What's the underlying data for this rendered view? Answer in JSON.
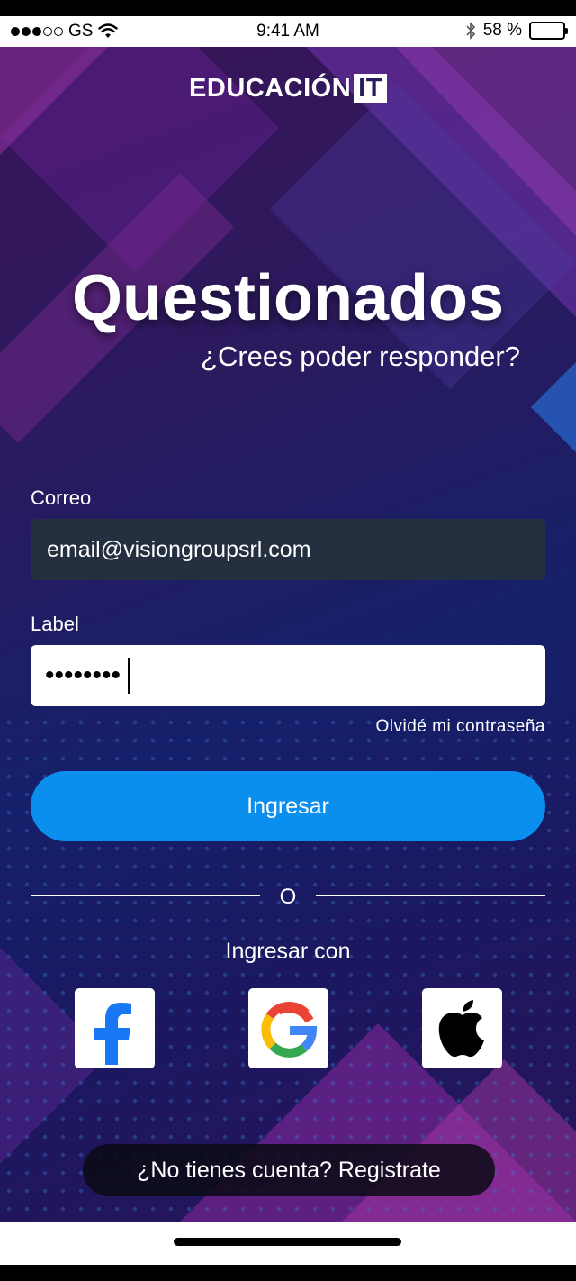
{
  "status_bar": {
    "carrier": "GS",
    "time": "9:41 AM",
    "battery": "58 %",
    "battery_level": 0.58
  },
  "brand": {
    "name": "EDUCACIÓN",
    "suffix": "IT"
  },
  "hero": {
    "title": "Questionados",
    "subtitle": "¿Crees poder responder?"
  },
  "form": {
    "email_label": "Correo",
    "email_value": "email@visiongroupsrl.com",
    "password_label": "Label",
    "password_value": "••••••••",
    "forgot_link": "Olvidé mi contraseña",
    "login_button": "Ingresar"
  },
  "divider": {
    "text": "O"
  },
  "social": {
    "caption": "Ingresar con",
    "providers": [
      "facebook-icon",
      "google-icon",
      "apple-icon"
    ]
  },
  "register": {
    "text": "¿No tienes cuenta? Registrate"
  },
  "colors": {
    "primary": "#0a8fee",
    "field_dark": "#243040",
    "facebook": "#1877f2"
  }
}
